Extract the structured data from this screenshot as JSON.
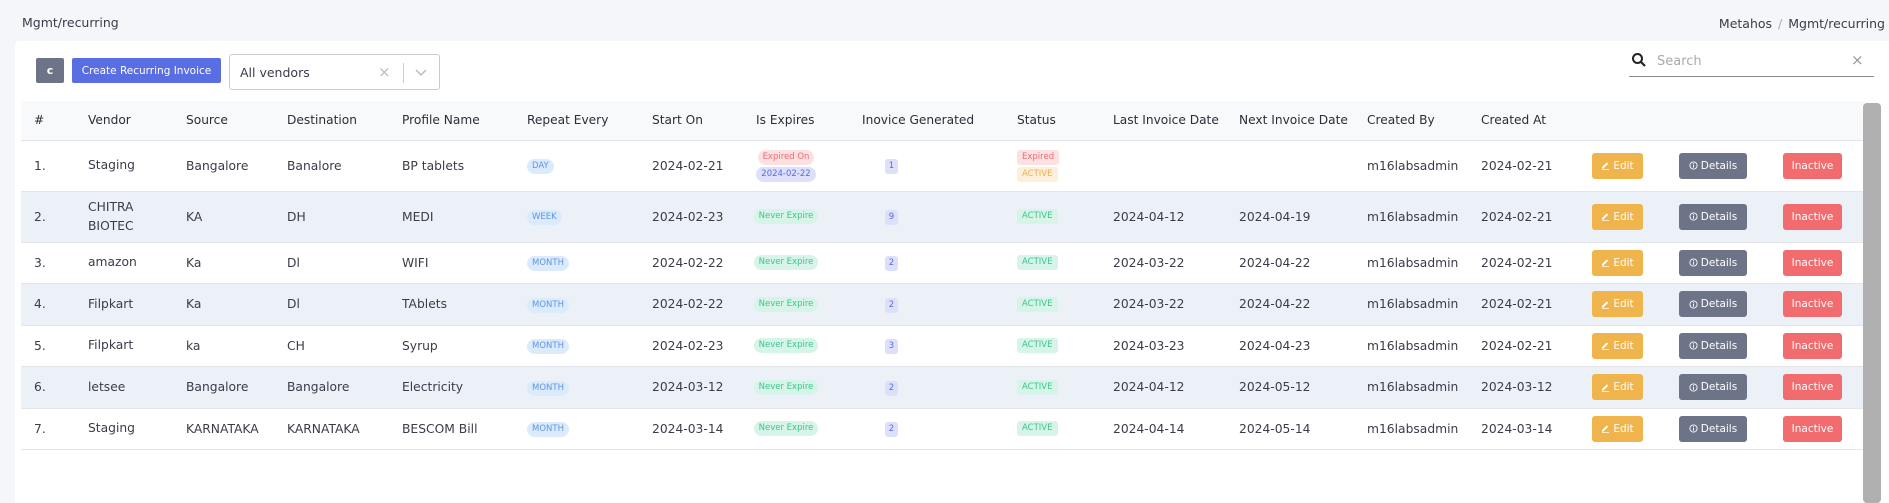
{
  "header": {
    "title": "Mgmt/recurring",
    "breadcrumb": [
      {
        "label": "Metahos"
      },
      {
        "label": "Mgmt/recurring"
      }
    ],
    "breadcrumb_separator": "/"
  },
  "toolbar": {
    "refresh_icon": "refresh-icon",
    "refresh_label": "c",
    "create_label": "Create Recurring Invoice",
    "vendor_filter": {
      "value": "All vendors",
      "clear_icon": "×"
    },
    "search": {
      "placeholder": "Search",
      "value": "",
      "clear_icon": "×"
    }
  },
  "table": {
    "columns": [
      "#",
      "Vendor",
      "Source",
      "Destination",
      "Profile Name",
      "Repeat Every",
      "Start On",
      "Is Expires",
      "Inovice Generated",
      "Status",
      "Last Invoice Date",
      "Next Invoice Date",
      "Created By",
      "Created At",
      "",
      "",
      ""
    ],
    "action_labels": {
      "edit": "Edit",
      "details": "Details",
      "inactive": "Inactive"
    },
    "rows": [
      {
        "num": "1.",
        "vendor": "Staging",
        "source": "Bangalore",
        "destination": "Banalore",
        "profile": "BP tablets",
        "repeat": "DAY",
        "start_on": "2024-02-21",
        "expires": {
          "type": "expired",
          "label": "Expired On",
          "date": "2024-02-22"
        },
        "generated": "1",
        "status": [
          "Expired",
          "ACTIVE"
        ],
        "last_invoice": "",
        "next_invoice": "",
        "created_by": "m16labsadmin",
        "created_at": "2024-02-21"
      },
      {
        "num": "2.",
        "vendor": "CHITRA BIOTEC",
        "source": "KA",
        "destination": "DH",
        "profile": "MEDI",
        "repeat": "WEEK",
        "start_on": "2024-02-23",
        "expires": {
          "type": "never",
          "label": "Never Expire"
        },
        "generated": "9",
        "status": [
          "ACTIVE"
        ],
        "last_invoice": "2024-04-12",
        "next_invoice": "2024-04-19",
        "created_by": "m16labsadmin",
        "created_at": "2024-02-21"
      },
      {
        "num": "3.",
        "vendor": "amazon",
        "source": "Ka",
        "destination": "Dl",
        "profile": "WIFI",
        "repeat": "MONTH",
        "start_on": "2024-02-22",
        "expires": {
          "type": "never",
          "label": "Never Expire"
        },
        "generated": "2",
        "status": [
          "ACTIVE"
        ],
        "last_invoice": "2024-03-22",
        "next_invoice": "2024-04-22",
        "created_by": "m16labsadmin",
        "created_at": "2024-02-21"
      },
      {
        "num": "4.",
        "vendor": "Filpkart",
        "source": "Ka",
        "destination": "Dl",
        "profile": "TAblets",
        "repeat": "MONTH",
        "start_on": "2024-02-22",
        "expires": {
          "type": "never",
          "label": "Never Expire"
        },
        "generated": "2",
        "status": [
          "ACTIVE"
        ],
        "last_invoice": "2024-03-22",
        "next_invoice": "2024-04-22",
        "created_by": "m16labsadmin",
        "created_at": "2024-02-21"
      },
      {
        "num": "5.",
        "vendor": "Filpkart",
        "source": "ka",
        "destination": "CH",
        "profile": "Syrup",
        "repeat": "MONTH",
        "start_on": "2024-02-23",
        "expires": {
          "type": "never",
          "label": "Never Expire"
        },
        "generated": "3",
        "status": [
          "ACTIVE"
        ],
        "last_invoice": "2024-03-23",
        "next_invoice": "2024-04-23",
        "created_by": "m16labsadmin",
        "created_at": "2024-02-21"
      },
      {
        "num": "6.",
        "vendor": "letsee",
        "source": "Bangalore",
        "destination": "Bangalore",
        "profile": "Electricity",
        "repeat": "MONTH",
        "start_on": "2024-03-12",
        "expires": {
          "type": "never",
          "label": "Never Expire"
        },
        "generated": "2",
        "status": [
          "ACTIVE"
        ],
        "last_invoice": "2024-04-12",
        "next_invoice": "2024-05-12",
        "created_by": "m16labsadmin",
        "created_at": "2024-03-12"
      },
      {
        "num": "7.",
        "vendor": "Staging",
        "source": "KARNATAKA",
        "destination": "KARNATAKA",
        "profile": "BESCOM Bill",
        "repeat": "MONTH",
        "start_on": "2024-03-14",
        "expires": {
          "type": "never",
          "label": "Never Expire"
        },
        "generated": "2",
        "status": [
          "ACTIVE"
        ],
        "last_invoice": "2024-04-14",
        "next_invoice": "2024-05-14",
        "created_by": "m16labsadmin",
        "created_at": "2024-03-14"
      }
    ]
  },
  "colors": {
    "primary": "#5a6ee4",
    "secondary": "#6e7487",
    "warning": "#f0b44c",
    "danger": "#f26b6e",
    "success": "#3fc48f"
  }
}
